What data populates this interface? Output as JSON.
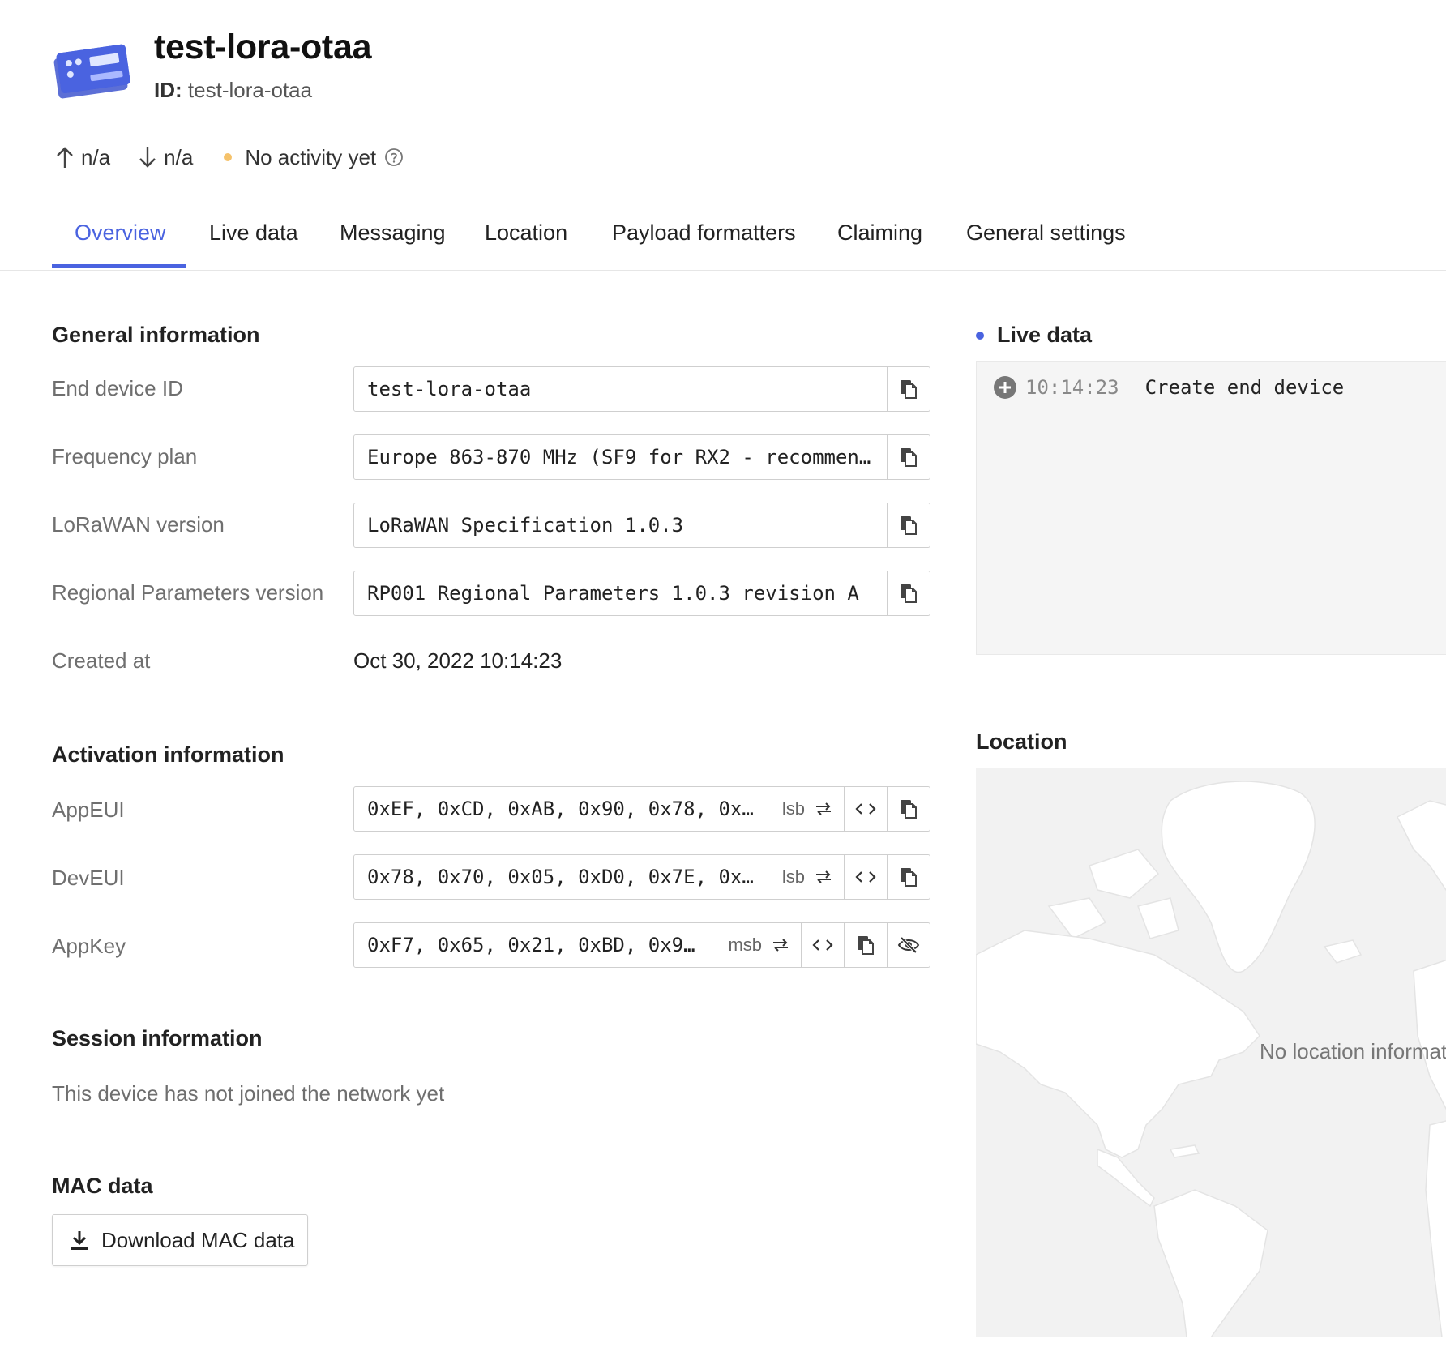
{
  "header": {
    "title": "test-lora-otaa",
    "id_label": "ID:",
    "id_value": "test-lora-otaa"
  },
  "activity": {
    "uplink": "n/a",
    "downlink": "n/a",
    "status": "No activity yet",
    "status_color": "#f5c26b"
  },
  "tabs": [
    {
      "label": "Overview",
      "active": true
    },
    {
      "label": "Live data"
    },
    {
      "label": "Messaging"
    },
    {
      "label": "Location"
    },
    {
      "label": "Payload formatters"
    },
    {
      "label": "Claiming"
    },
    {
      "label": "General settings"
    }
  ],
  "general": {
    "title": "General information",
    "rows": [
      {
        "label": "End device ID",
        "value": "test-lora-otaa"
      },
      {
        "label": "Frequency plan",
        "value": "Europe 863-870 MHz (SF9 for RX2 - recommen…"
      },
      {
        "label": "LoRaWAN version",
        "value": "LoRaWAN Specification 1.0.3"
      },
      {
        "label": "Regional Parameters version",
        "value": "RP001 Regional Parameters 1.0.3 revision A"
      }
    ],
    "created_label": "Created at",
    "created_value": "Oct 30, 2022 10:14:23"
  },
  "activation": {
    "title": "Activation information",
    "rows": [
      {
        "label": "AppEUI",
        "value": "0xEF, 0xCD, 0xAB, 0x90, 0x78, 0x…",
        "order": "lsb"
      },
      {
        "label": "DevEUI",
        "value": "0x78, 0x70, 0x05, 0xD0, 0x7E, 0x…",
        "order": "lsb"
      },
      {
        "label": "AppKey",
        "value": "0xF7, 0x65, 0x21, 0xBD, 0x9…",
        "order": "msb"
      }
    ]
  },
  "session": {
    "title": "Session information",
    "note": "This device has not joined the network yet"
  },
  "mac": {
    "title": "MAC data",
    "button": "Download MAC data"
  },
  "live": {
    "title": "Live data",
    "events": [
      {
        "time": "10:14:23",
        "text": "Create end device"
      }
    ]
  },
  "location": {
    "title": "Location",
    "message": "No location information"
  },
  "colors": {
    "accent": "#4a63e0",
    "status_idle": "#f5c26b"
  }
}
